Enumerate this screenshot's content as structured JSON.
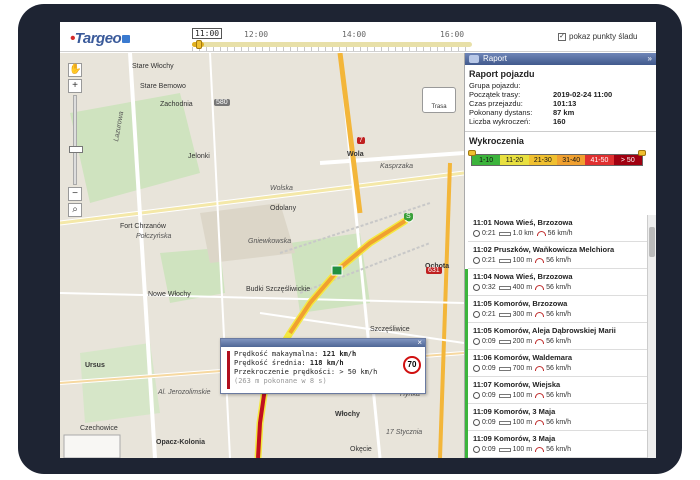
{
  "app": {
    "logo": "Targeo",
    "show_points_label": "pokaz punkty śladu",
    "show_points_checked": true
  },
  "timeline": {
    "labels": [
      "11:00",
      "12:00",
      "14:00",
      "16:00"
    ],
    "current": "11:00"
  },
  "map": {
    "route_button_label": "Trasa",
    "labels": [
      {
        "text": "Stare Włochy",
        "cls": "map-label"
      },
      {
        "text": "Wola",
        "cls": "map-label"
      },
      {
        "text": "Ochota",
        "cls": "map-label"
      },
      {
        "text": "Kasprzaka",
        "cls": "map-label road"
      },
      {
        "text": "Wolska",
        "cls": "map-label road"
      },
      {
        "text": "Połczyńska",
        "cls": "map-label road"
      },
      {
        "text": "Ursus",
        "cls": "map-label"
      },
      {
        "text": "Włochy",
        "cls": "map-label"
      },
      {
        "text": "Al. Jerozolimskie",
        "cls": "map-label road"
      },
      {
        "text": "Opacz-Kolonia",
        "cls": "map-label"
      },
      {
        "text": "17 Stycznia",
        "cls": "map-label road"
      },
      {
        "text": "Hynka",
        "cls": "map-label road"
      },
      {
        "text": "Okęcie",
        "cls": "map-label"
      },
      {
        "text": "Odolany",
        "cls": "map-label"
      },
      {
        "text": "Jelonki",
        "cls": "map-label"
      },
      {
        "text": "Szczęśliwice",
        "cls": "map-label"
      },
      {
        "text": "Budki Szczęśliwickie",
        "cls": "map-label"
      },
      {
        "text": "Fort Chrzanów",
        "cls": "map-label"
      },
      {
        "text": "Lazurowa",
        "cls": "map-label road"
      },
      {
        "text": "Gniewkowska",
        "cls": "map-label road"
      },
      {
        "text": "Czechowice",
        "cls": "map-label"
      },
      {
        "text": "Nowe Włochy",
        "cls": "map-label"
      },
      {
        "text": "Stare Bemowo",
        "cls": "map-label"
      },
      {
        "text": "Zachodnia",
        "cls": "map-label"
      }
    ],
    "road_badges": [
      "580",
      "7",
      "631",
      "S"
    ]
  },
  "popup": {
    "max_speed_label": "Prędkość makaymalna:",
    "max_speed_value": "121 km/h",
    "avg_speed_label": "Prędkość średnia:",
    "avg_speed_value": "118 km/h",
    "excess_label": "Przekroczenie prędkości:",
    "excess_value": "> 50 km/h",
    "note": "(263 m pokonane w 8 s)",
    "speed_limit": "70",
    "close": "×"
  },
  "panel": {
    "header": "Raport",
    "collapse": "»",
    "report_title": "Raport pojazdu",
    "fields": [
      {
        "k": "Grupa pojazdu:",
        "v": ""
      },
      {
        "k": "Początek trasy:",
        "v": "2019-02-24 11:00"
      },
      {
        "k": "Czas przejazdu:",
        "v": "101:13"
      },
      {
        "k": "Pokonany dystans:",
        "v": "87 km"
      },
      {
        "k": "Liczba wykroczeń:",
        "v": "160"
      }
    ],
    "violations_title": "Wykroczenia",
    "legend": [
      {
        "label": "1-10",
        "color": "#3cb43c"
      },
      {
        "label": "11-20",
        "color": "#e8e040"
      },
      {
        "label": "21-30",
        "color": "#f0c030"
      },
      {
        "label": "31-40",
        "color": "#f0a030"
      },
      {
        "label": "41-50",
        "color": "#e03030"
      },
      {
        "label": "> 50",
        "color": "#a00010"
      }
    ],
    "items": [
      {
        "title": "11:01 Nowa Wieś, Brzozowa",
        "time": "0:21",
        "dist": "1.0 km",
        "speed": "56 km/h",
        "color": "#ffffff"
      },
      {
        "title": "11:02 Pruszków, Waňkowicza Melchiora",
        "time": "0:21",
        "dist": "100 m",
        "speed": "56 km/h",
        "color": "#ffffff"
      },
      {
        "title": "11:04 Nowa Wieś, Brzozowa",
        "time": "0:32",
        "dist": "400 m",
        "speed": "56 km/h",
        "color": "#3cb43c"
      },
      {
        "title": "11:05 Komorów, Brzozowa",
        "time": "0:21",
        "dist": "300 m",
        "speed": "56 km/h",
        "color": "#3cb43c"
      },
      {
        "title": "11:05 Komorów, Aleja Dąbrowskiej Marii",
        "time": "0:09",
        "dist": "200 m",
        "speed": "56 km/h",
        "color": "#3cb43c"
      },
      {
        "title": "11:06 Komorów, Waldemara",
        "time": "0:09",
        "dist": "700 m",
        "speed": "56 km/h",
        "color": "#3cb43c"
      },
      {
        "title": "11:07 Komorów, Wiejska",
        "time": "0:09",
        "dist": "100 m",
        "speed": "56 km/h",
        "color": "#3cb43c"
      },
      {
        "title": "11:09 Komorów, 3 Maja",
        "time": "0:09",
        "dist": "100 m",
        "speed": "56 km/h",
        "color": "#3cb43c"
      },
      {
        "title": "11:09 Komorów, 3 Maja",
        "time": "0:09",
        "dist": "100 m",
        "speed": "56 km/h",
        "color": "#3cb43c"
      }
    ]
  }
}
